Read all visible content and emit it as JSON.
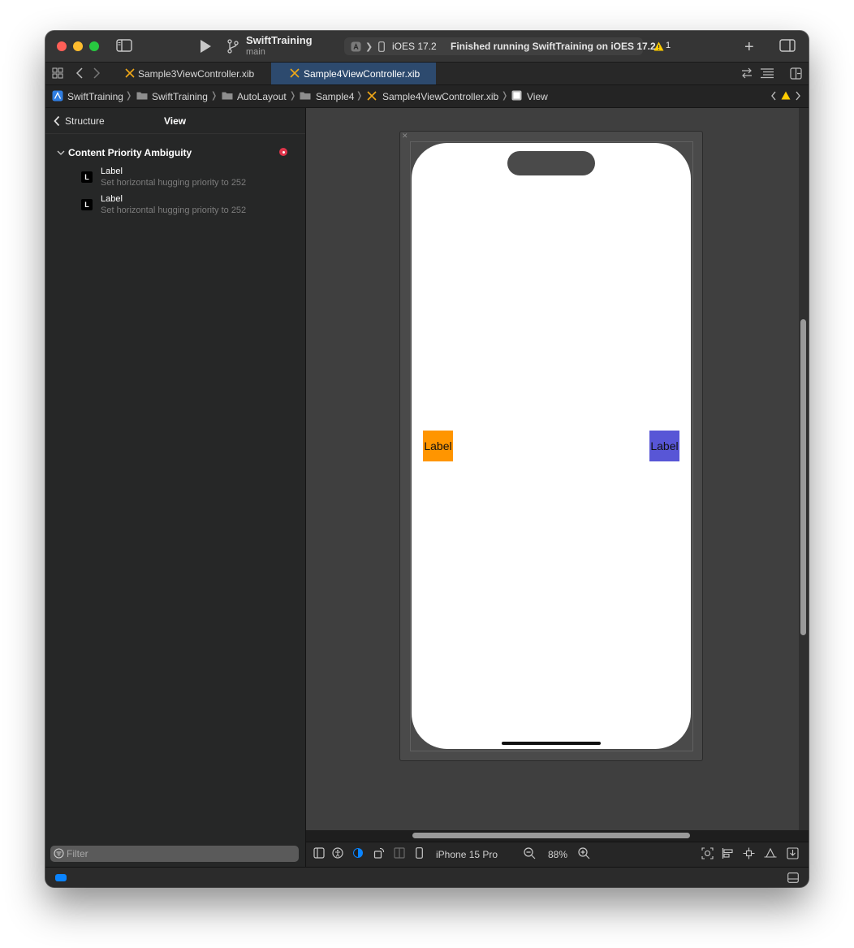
{
  "toolbar": {
    "project_name": "SwiftTraining",
    "branch": "main",
    "destination": "iOES 17.2",
    "status": "Finished running SwiftTraining on iOES 17.2",
    "warning_count": "1"
  },
  "tabs": [
    {
      "label": "Sample3ViewController.xib",
      "active": false
    },
    {
      "label": "Sample4ViewController.xib",
      "active": true
    }
  ],
  "breadcrumb": [
    "SwiftTraining",
    "SwiftTraining",
    "AutoLayout",
    "Sample4",
    "Sample4ViewController.xib",
    "View"
  ],
  "sidebar": {
    "back_label": "Structure",
    "title": "View",
    "issue_group": "Content Priority Ambiguity",
    "issues": [
      {
        "icon": "L",
        "title": "Label",
        "detail": "Set horizontal hugging priority to 252"
      },
      {
        "icon": "L",
        "title": "Label",
        "detail": "Set horizontal hugging priority to 252"
      }
    ],
    "filter_placeholder": "Filter"
  },
  "canvas": {
    "labels": [
      {
        "text": "Label",
        "color": "#ff9500"
      },
      {
        "text": "Label",
        "color": "#5856d6"
      }
    ]
  },
  "bottom_bar": {
    "device": "iPhone 15 Pro",
    "zoom": "88%"
  },
  "colors": {
    "accent": "#0a84ff",
    "warning": "#ffcc00",
    "error": "#e0344a"
  }
}
